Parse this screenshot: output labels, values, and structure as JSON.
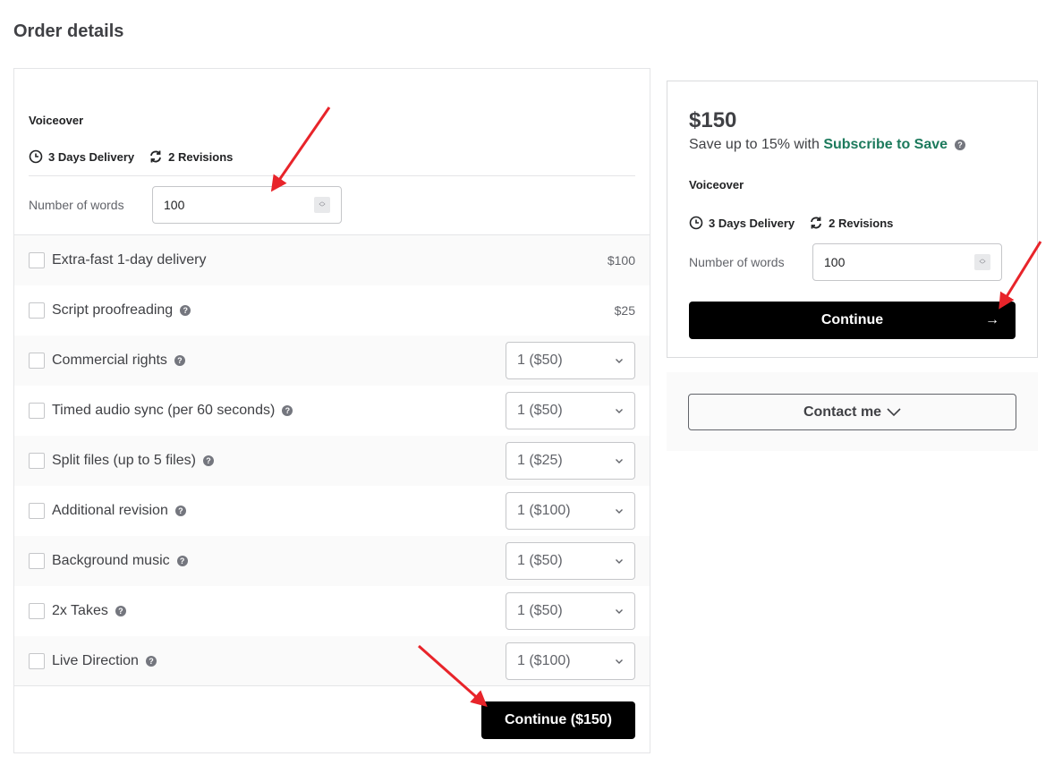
{
  "page": {
    "title": "Order details"
  },
  "order": {
    "package_name": "Voiceover",
    "delivery": "3 Days Delivery",
    "revisions": "2 Revisions",
    "words_label": "Number of words",
    "words_value": "100",
    "extras": [
      {
        "label": "Extra-fast 1-day delivery",
        "help": false,
        "price": "$100",
        "qty": null
      },
      {
        "label": "Script proofreading",
        "help": true,
        "price": "$25",
        "qty": null
      },
      {
        "label": "Commercial rights",
        "help": true,
        "price": null,
        "qty": "1 ($50)"
      },
      {
        "label": "Timed audio sync (per 60 seconds)",
        "help": true,
        "price": null,
        "qty": "1 ($50)"
      },
      {
        "label": "Split files (up to 5 files)",
        "help": true,
        "price": null,
        "qty": "1 ($25)"
      },
      {
        "label": "Additional revision",
        "help": true,
        "price": null,
        "qty": "1 ($100)"
      },
      {
        "label": "Background music",
        "help": true,
        "price": null,
        "qty": "1 ($50)"
      },
      {
        "label": "2x Takes",
        "help": true,
        "price": null,
        "qty": "1 ($50)"
      },
      {
        "label": "Live Direction",
        "help": true,
        "price": null,
        "qty": "1 ($100)"
      }
    ],
    "continue_label": "Continue ($150)"
  },
  "summary": {
    "price": "$150",
    "save_prefix": "Save up to 15% with ",
    "save_link": "Subscribe to Save",
    "package_name": "Voiceover",
    "delivery": "3 Days Delivery",
    "revisions": "2 Revisions",
    "words_label": "Number of words",
    "words_value": "100",
    "continue_label": "Continue",
    "continue_arrow": "→",
    "contact_label": "Contact me"
  },
  "colors": {
    "accent_green": "#1c7a5c",
    "annotation_red": "#e8242a",
    "button_black": "#000000"
  }
}
